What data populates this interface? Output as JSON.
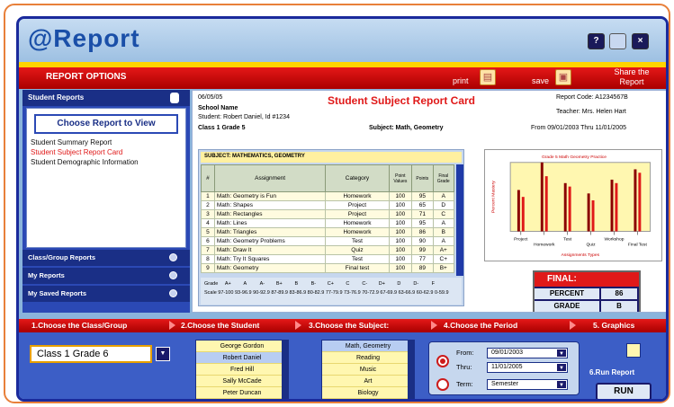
{
  "app": {
    "title": "@Report"
  },
  "window_buttons": {
    "help": "?",
    "close": "×"
  },
  "options_bar": {
    "title": "REPORT OPTIONS",
    "print_label": "print",
    "save_label": "save",
    "share_label": "Share the Report"
  },
  "sidebar": {
    "header": "Student Reports",
    "choose_title": "Choose Report to View",
    "items": [
      "Student Summary Report",
      "Student Subject Report Card",
      "Student Demographic Information"
    ],
    "sections": [
      "Class/Group Reports",
      "My Reports",
      "My Saved Reports"
    ]
  },
  "report": {
    "title": "Student Subject Report Card",
    "date": "06/05/05",
    "school": "School Name",
    "student": "Student:  Robert Daniel, Id #1234",
    "class": "Class 1 Grade 5",
    "subject": "Subject:  Math, Geometry",
    "report_code": "Report Code: A1234567B",
    "teacher": "Teacher:  Mrs. Helen Hart",
    "period": "From 09/01/2003  Thru 11/01/2005",
    "grid_header": "SUBJECT:  MATHEMATICS, GEOMETRY",
    "columns": [
      "#",
      "Assignment",
      "Category",
      "Point Values",
      "Points",
      "Final Grade"
    ],
    "rows": [
      [
        "1",
        "Math: Geometry is Fun",
        "Homework",
        "100",
        "95",
        "A"
      ],
      [
        "2",
        "Math: Shapes",
        "Project",
        "100",
        "65",
        "D"
      ],
      [
        "3",
        "Math: Rectangles",
        "Project",
        "100",
        "71",
        "C"
      ],
      [
        "4",
        "Math: Lines",
        "Homework",
        "100",
        "95",
        "A"
      ],
      [
        "5",
        "Math: Triangles",
        "Homework",
        "100",
        "86",
        "B"
      ],
      [
        "6",
        "Math: Geometry Problems",
        "Test",
        "100",
        "90",
        "A"
      ],
      [
        "7",
        "Math: Draw It",
        "Quiz",
        "100",
        "99",
        "A+"
      ],
      [
        "8",
        "Math: Try It Squares",
        "Test",
        "100",
        "77",
        "C+"
      ],
      [
        "9",
        "Math: Geometry",
        "Final test",
        "100",
        "89",
        "B+"
      ]
    ],
    "grade_scale_label": "Grade",
    "grade_scale": [
      "A+",
      "A",
      "A-",
      "B+",
      "B",
      "B-",
      "C+",
      "C",
      "C-",
      "D+",
      "D",
      "D-",
      "F"
    ],
    "scale_label": "Scale",
    "scale_values": "97-100  93-96.9  90-92.9  87-89.9  83-86.9  80-82.9  77-79.9  73-76.9  70-72.9  67-69.9  63-66.9  60-62.9  0-59.9"
  },
  "chart_data": {
    "type": "bar",
    "title": "Grade 5 Math Geometry Practice",
    "ylabel": "Percent Mastery",
    "xlabel": "Assignments Types",
    "categories": [
      "Project",
      "Homework",
      "Test",
      "Quiz",
      "Workshop",
      "Final Test"
    ],
    "series": [
      {
        "color": "#8a0000",
        "values": [
          60,
          100,
          70,
          55,
          75,
          90
        ]
      },
      {
        "color": "#e01919",
        "values": [
          50,
          80,
          65,
          45,
          70,
          85
        ]
      }
    ],
    "ylim": [
      0,
      100
    ],
    "legend": "none"
  },
  "final": {
    "title": "FINAL:",
    "percent_label": "PERCENT",
    "percent_value": "86",
    "grade_label": "GRADE",
    "grade_value": "B"
  },
  "steps": [
    "1.Choose the Class/Group",
    "2.Choose the Student",
    "3.Choose the Subject:",
    "4.Choose the Period",
    "5. Graphics"
  ],
  "controls": {
    "class_value": "Class 1 Grade 6",
    "students": [
      "George Gordon",
      "Robert Daniel",
      "Fred Hill",
      "Sally McCade",
      "Peter Duncan"
    ],
    "subjects": [
      "Math, Geometry",
      "Reading",
      "Music",
      "Art",
      "Biology"
    ],
    "from_label": "From:",
    "from_value": "09/01/2003",
    "thru_label": "Thru:",
    "thru_value": "11/01/2005",
    "term_label": "Term:",
    "term_value": "Semester",
    "run_report_label": "6.Run Report",
    "run_button": "RUN"
  },
  "colors": {
    "accent_red": "#e01919",
    "brand_blue": "#2b49b5",
    "frame_orange": "#e8803a"
  }
}
